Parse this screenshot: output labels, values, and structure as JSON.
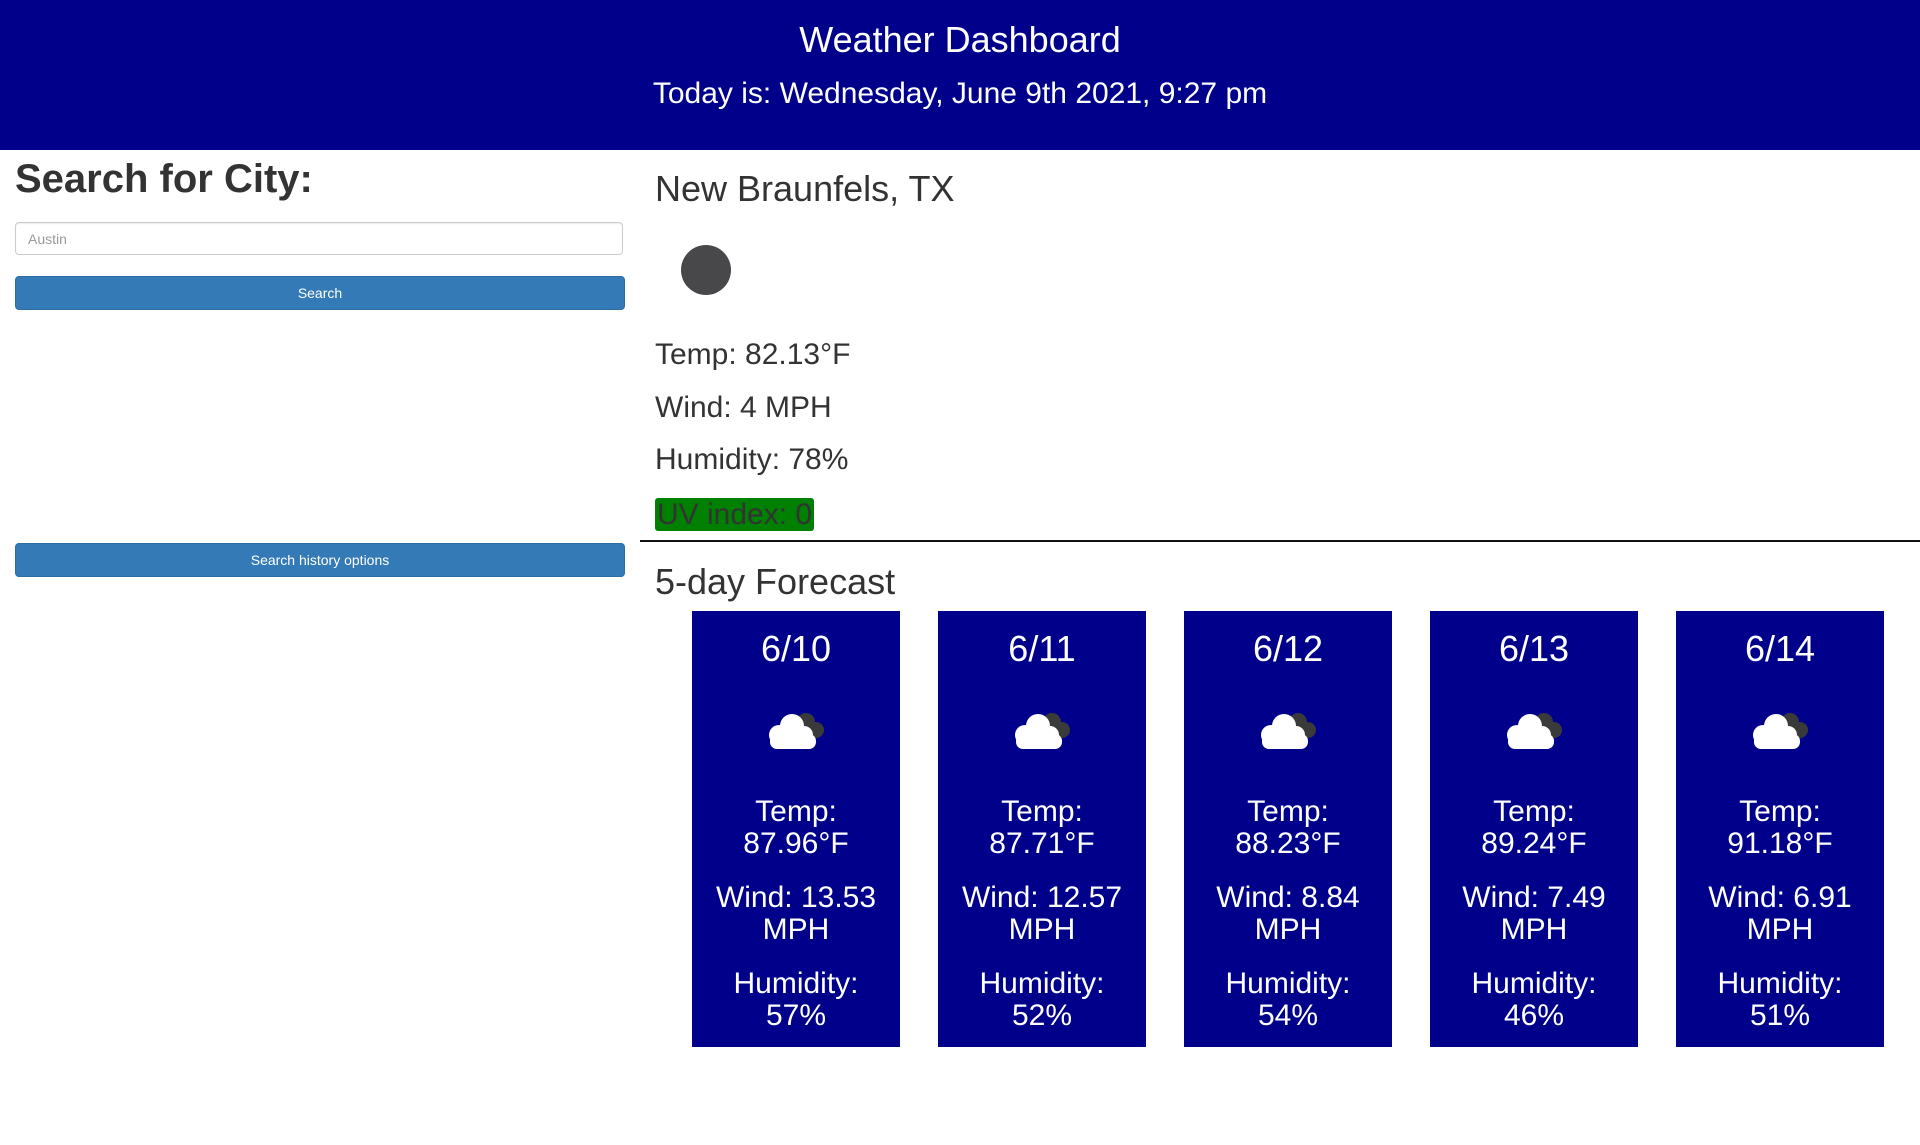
{
  "header": {
    "title": "Weather Dashboard",
    "today": "Today is: Wednesday, June 9th 2021, 9:27 pm",
    "background_color": "#00008b"
  },
  "sidebar": {
    "search_title": "Search for City:",
    "search_input": {
      "value": "",
      "placeholder": "Austin"
    },
    "search_button_label": "Search",
    "history_button_label": "Search history options",
    "button_color": "#337ab7"
  },
  "current": {
    "city": "New Braunfels, TX",
    "icon": "weather-icon",
    "temp": "Temp: 82.13°F",
    "wind": "Wind: 4 MPH",
    "humidity": "Humidity: 78%",
    "uv": "UV index: 0",
    "uv_color": "#008000"
  },
  "forecast": {
    "title": "5-day Forecast",
    "card_color": "#00008b",
    "days": [
      {
        "date": "6/10",
        "icon": "cloud-icon",
        "temp_label": "Temp:",
        "temp": "87.96°F",
        "wind_label": "Wind: 13.53",
        "wind_unit": "MPH",
        "humidity_label": "Humidity:",
        "humidity": "57%"
      },
      {
        "date": "6/11",
        "icon": "cloud-icon",
        "temp_label": "Temp:",
        "temp": "87.71°F",
        "wind_label": "Wind: 12.57",
        "wind_unit": "MPH",
        "humidity_label": "Humidity:",
        "humidity": "52%"
      },
      {
        "date": "6/12",
        "icon": "cloud-icon",
        "temp_label": "Temp:",
        "temp": "88.23°F",
        "wind_label": "Wind: 8.84",
        "wind_unit": "MPH",
        "humidity_label": "Humidity:",
        "humidity": "54%"
      },
      {
        "date": "6/13",
        "icon": "cloud-icon",
        "temp_label": "Temp:",
        "temp": "89.24°F",
        "wind_label": "Wind: 7.49",
        "wind_unit": "MPH",
        "humidity_label": "Humidity:",
        "humidity": "46%"
      },
      {
        "date": "6/14",
        "icon": "cloud-icon",
        "temp_label": "Temp:",
        "temp": "91.18°F",
        "wind_label": "Wind: 6.91",
        "wind_unit": "MPH",
        "humidity_label": "Humidity:",
        "humidity": "51%"
      }
    ]
  }
}
